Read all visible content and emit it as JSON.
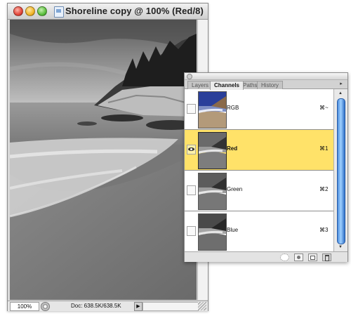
{
  "window": {
    "title": "Shoreline copy @ 100% (Red/8)",
    "zoom": "100%",
    "doc_size": "Doc: 638.5K/638.5K"
  },
  "palette": {
    "tabs": [
      {
        "label": "Layers",
        "active": false
      },
      {
        "label": "Channels",
        "active": true
      },
      {
        "label": "Paths",
        "active": false
      },
      {
        "label": "History",
        "active": false
      }
    ],
    "channels": [
      {
        "name": "RGB",
        "shortcut": "⌘~",
        "visible": false,
        "selected": false
      },
      {
        "name": "Red",
        "shortcut": "⌘1",
        "visible": true,
        "selected": true
      },
      {
        "name": "Green",
        "shortcut": "⌘2",
        "visible": false,
        "selected": false
      },
      {
        "name": "Blue",
        "shortcut": "⌘3",
        "visible": false,
        "selected": false
      }
    ],
    "selection_color": "#ffe269",
    "scroll_color": "#4d8fe0"
  }
}
